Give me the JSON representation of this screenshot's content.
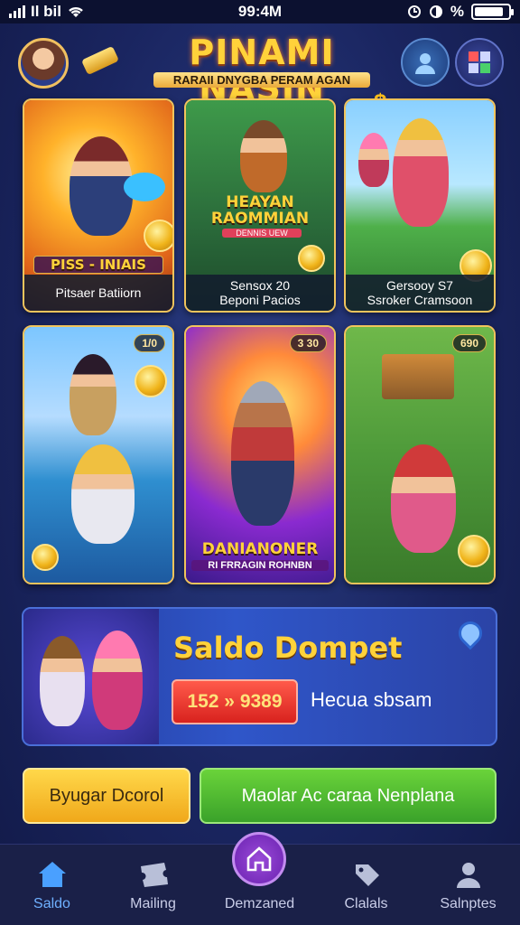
{
  "status_bar": {
    "carrier": "Il bil",
    "time": "99:4M",
    "indicators": "%"
  },
  "header": {
    "title": "PINAMI NASIN",
    "subtitle": "RARAII DNYGBA PERAM AGAN",
    "currency_symbol": "$",
    "icons": [
      "avatar",
      "gold-bar-icon",
      "profile-icon",
      "menu-grid-icon"
    ]
  },
  "games": [
    {
      "name": "Pitsaer Batiiorn",
      "banner": "PISS - INIAIS"
    },
    {
      "name": "Sensox 20\nBeponi Pacios",
      "banner": "HEAYAN RAOMMIAN",
      "banner_sub": "DENNIS UEW"
    },
    {
      "name": "Gersooy S7\nSsroker Cramsoon"
    },
    {
      "name": "",
      "badge": "1/0"
    },
    {
      "name": "",
      "badge": "3 30",
      "banner": "DANIANONER",
      "banner_sub": "RI FRRAGIN ROHNBN"
    },
    {
      "name": "",
      "badge": "690"
    }
  ],
  "wallet": {
    "title": "Saldo Dompet",
    "balance": "152 » 9389",
    "note": "Hecua sbsam"
  },
  "actions": {
    "primary_label": "Byugar Dcorol",
    "secondary_label": "Maolar Ac caraa Nenplana"
  },
  "nav": {
    "items": [
      {
        "label": "Saldo",
        "icon": "home-icon",
        "active": true
      },
      {
        "label": "Mailing",
        "icon": "ticket-icon"
      },
      {
        "label": "Demzaned",
        "icon": "home-center-icon"
      },
      {
        "label": "Clalals",
        "icon": "tag-icon"
      },
      {
        "label": "Salnptes",
        "icon": "user-icon"
      }
    ]
  },
  "colors": {
    "accent_gold": "#ffd23a",
    "background": "#1a2560",
    "nav_active": "#6fb0ff",
    "wallet_blue": "#2f56c9",
    "button_red": "#d8221e",
    "button_green": "#3aa22a",
    "button_yellow": "#f0a81a"
  }
}
